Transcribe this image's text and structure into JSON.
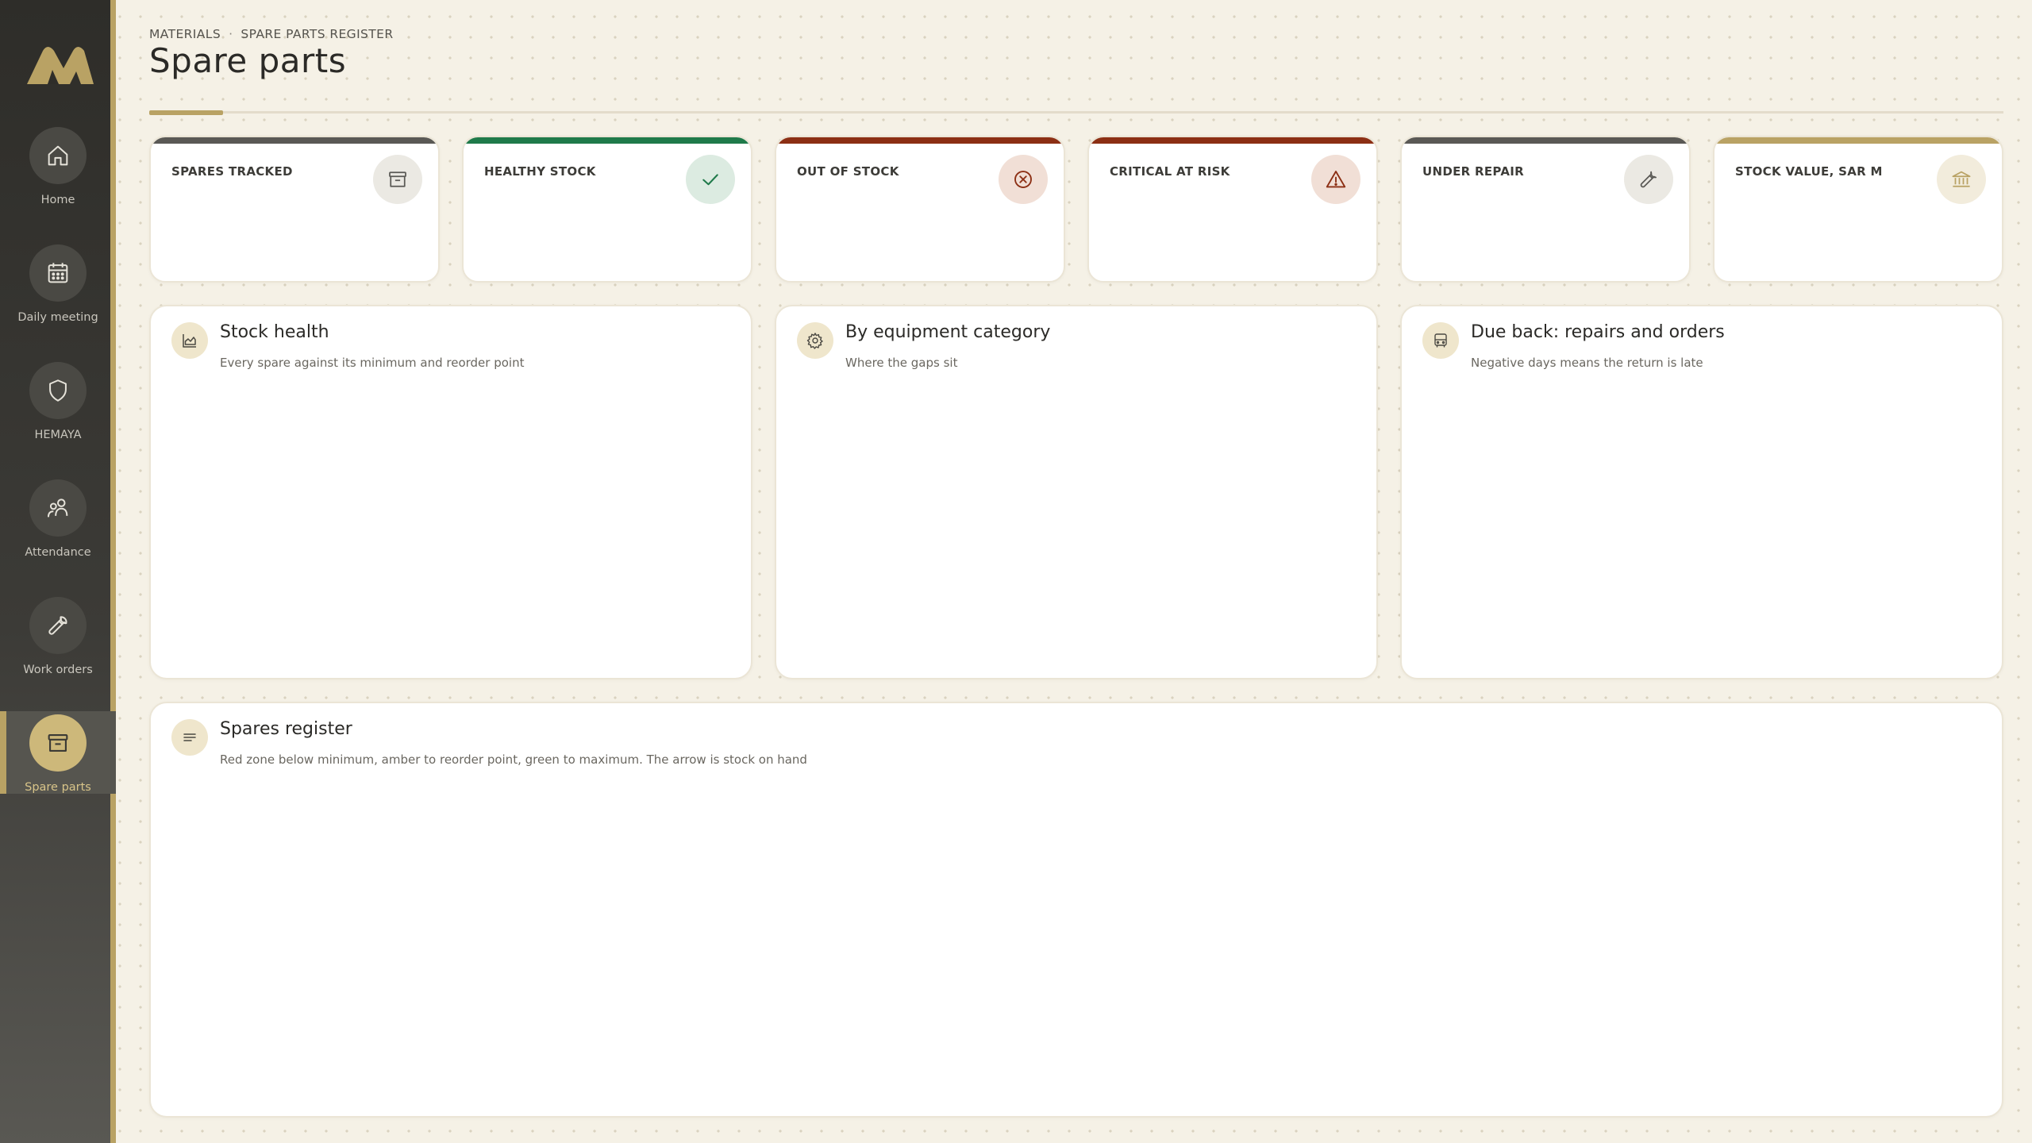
{
  "brand": {
    "accent": "#b9a264",
    "logo_icon": "brand-logo"
  },
  "sidebar": {
    "items": [
      {
        "label": "Home",
        "icon": "home-icon"
      },
      {
        "label": "Daily meeting",
        "icon": "calendar-icon"
      },
      {
        "label": "HEMAYA",
        "icon": "shield-icon"
      },
      {
        "label": "Attendance",
        "icon": "people-icon"
      },
      {
        "label": "Work orders",
        "icon": "wrench-icon"
      },
      {
        "label": "Spare parts",
        "icon": "box-icon",
        "active": true
      }
    ]
  },
  "header": {
    "breadcrumb": [
      "MATERIALS",
      "SPARE PARTS REGISTER"
    ],
    "breadcrumb_sep": "·",
    "title": "Spare parts"
  },
  "kpis": [
    {
      "label": "SPARES TRACKED",
      "icon": "box-icon",
      "color": "#5a5955"
    },
    {
      "label": "HEALTHY STOCK",
      "icon": "check-icon",
      "color": "#1f7a4a"
    },
    {
      "label": "OUT OF STOCK",
      "icon": "x-circle-icon",
      "color": "#8c2f14"
    },
    {
      "label": "CRITICAL AT RISK",
      "icon": "warning-icon",
      "color": "#8c2f14"
    },
    {
      "label": "UNDER REPAIR",
      "icon": "wrench-icon",
      "color": "#5a5955"
    },
    {
      "label": "STOCK VALUE, SAR M",
      "icon": "bank-icon",
      "color": "#b9a264"
    }
  ],
  "panels": {
    "stock_health": {
      "title": "Stock health",
      "subtitle": "Every spare against its minimum and reorder point",
      "icon": "chart-area-icon"
    },
    "by_category": {
      "title": "By equipment category",
      "subtitle": "Where the gaps sit",
      "icon": "gear-icon"
    },
    "due_back": {
      "title": "Due back: repairs and orders",
      "subtitle": "Negative days means the return is late",
      "icon": "bus-icon"
    },
    "register": {
      "title": "Spares register",
      "subtitle": "Red zone below minimum, amber to reorder point, green to maximum. The arrow is stock on hand",
      "icon": "lines-icon"
    }
  }
}
